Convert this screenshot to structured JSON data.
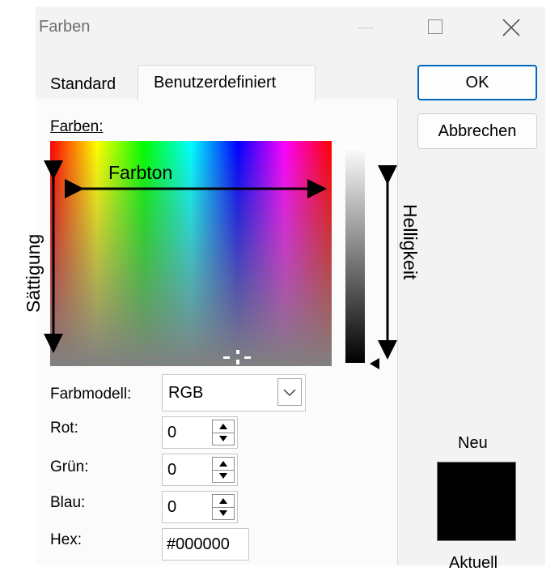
{
  "window": {
    "title": "Farben"
  },
  "tabs": [
    {
      "label": "Standard"
    },
    {
      "label": "Benutzerdefiniert"
    }
  ],
  "buttons": {
    "ok": "OK",
    "cancel": "Abbrechen"
  },
  "labels": {
    "farben": "Farben:",
    "farbmodell": "Farbmodell:",
    "rot": "Rot:",
    "gruen": "Grün:",
    "blau": "Blau:",
    "hex": "Hex:",
    "neu": "Neu",
    "aktuell": "Aktuell"
  },
  "annotations": {
    "farbton": "Farbton",
    "saettigung": "Sättigung",
    "helligkeit": "Helligkeit"
  },
  "fields": {
    "color_model": "RGB",
    "red": "0",
    "green": "0",
    "blue": "0",
    "hex": "#000000"
  },
  "preview": {
    "new_color": "#000000"
  },
  "colors": {
    "accent": "#0067c0"
  },
  "icons": {
    "minimize": "minimize-icon",
    "maximize": "maximize-icon",
    "close": "close-icon",
    "dropdown": "chevron-down-icon",
    "spin": "spin-up-down-icon"
  }
}
